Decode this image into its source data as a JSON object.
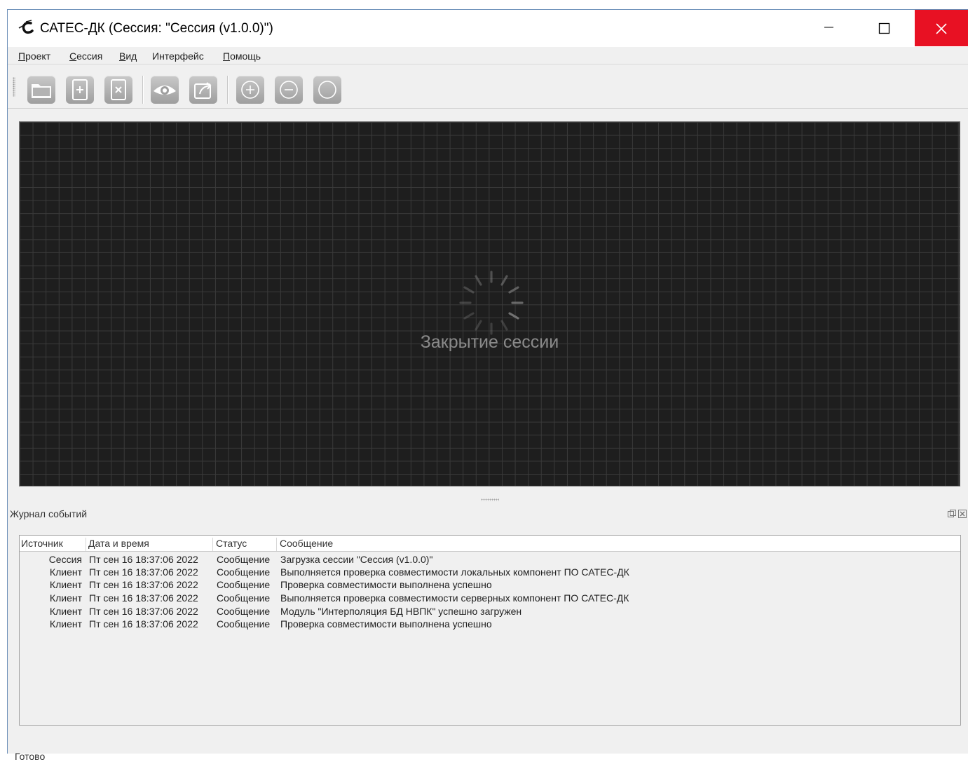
{
  "window": {
    "title": "САТЕС-ДК (Сессия: \"Сессия (v1.0.0)\")"
  },
  "menu": [
    {
      "key": "П",
      "rest": "роект"
    },
    {
      "key": "С",
      "rest": "ессия"
    },
    {
      "key": "В",
      "rest": "ид"
    },
    {
      "key": "",
      "rest": "Интерфейс"
    },
    {
      "key": "П",
      "rest": "омощь"
    }
  ],
  "toolbar": {
    "buttons": [
      "open-folder-icon",
      "new-file-icon",
      "close-file-icon",
      "view-eye-icon",
      "export-icon",
      "zoom-in-icon",
      "zoom-out-icon",
      "zoom-reset-icon"
    ]
  },
  "canvas": {
    "loading_text": "Закрытие сессии"
  },
  "log_panel": {
    "title": "Журнал событий",
    "columns": [
      "Источник",
      "Дата и время",
      "Статус",
      "Сообщение"
    ],
    "rows": [
      {
        "source": "Сессия",
        "datetime": "Пт сен 16 18:37:06 2022",
        "status": "Сообщение",
        "message": "Загрузка сессии \"Сессия (v1.0.0)\""
      },
      {
        "source": "Клиент",
        "datetime": "Пт сен 16 18:37:06 2022",
        "status": "Сообщение",
        "message": "Выполняется проверка совместимости локальных компонент ПО САТЕС-ДК"
      },
      {
        "source": "Клиент",
        "datetime": "Пт сен 16 18:37:06 2022",
        "status": "Сообщение",
        "message": "Проверка совместимости выполнена успешно"
      },
      {
        "source": "Клиент",
        "datetime": "Пт сен 16 18:37:06 2022",
        "status": "Сообщение",
        "message": "Выполняется проверка совместимости серверных компонент ПО САТЕС-ДК"
      },
      {
        "source": "Клиент",
        "datetime": "Пт сен 16 18:37:06 2022",
        "status": "Сообщение",
        "message": "Модуль \"Интерполяция БД НВПК\" успешно загружен"
      },
      {
        "source": "Клиент",
        "datetime": "Пт сен 16 18:37:06 2022",
        "status": "Сообщение",
        "message": "Проверка совместимости выполнена успешно"
      }
    ]
  },
  "status_bar": {
    "text": "Готово"
  },
  "colors": {
    "close_button": "#e81123",
    "canvas_bg": "#1e1e1e",
    "canvas_grid": "#3a3a3a"
  }
}
